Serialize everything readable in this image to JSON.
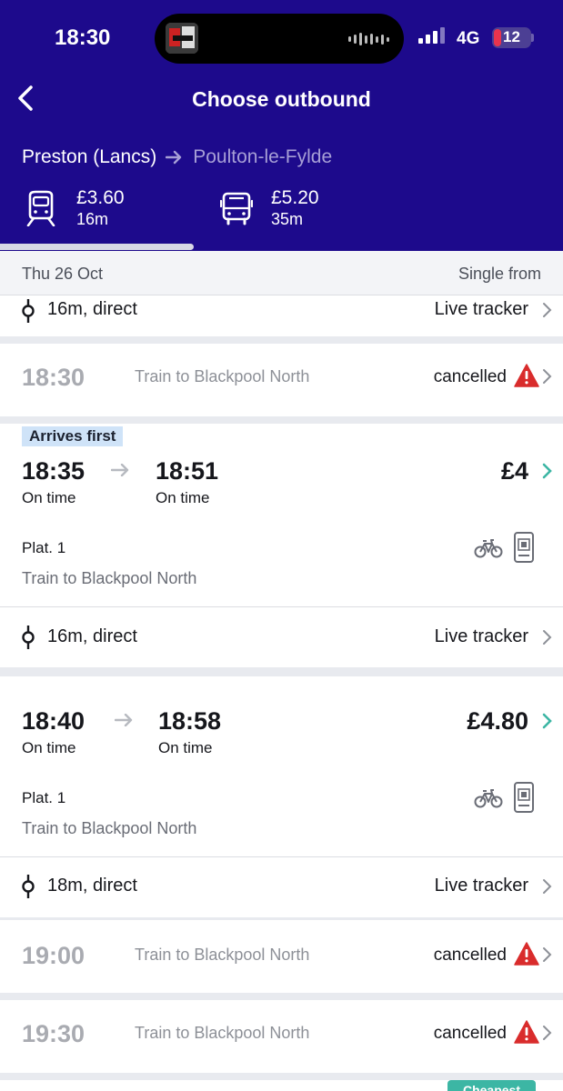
{
  "status_bar": {
    "time": "18:30",
    "network": "4G",
    "battery": "12"
  },
  "header": {
    "title": "Choose outbound",
    "origin": "Preston (Lancs)",
    "destination": "Poulton-le-Fylde",
    "modes": [
      {
        "icon": "train-icon",
        "price": "£3.60",
        "duration": "16m",
        "selected": true
      },
      {
        "icon": "bus-icon",
        "price": "£5.20",
        "duration": "35m",
        "selected": false
      }
    ]
  },
  "subheader": {
    "date": "Thu 26 Oct",
    "single_from": "Single from"
  },
  "partial_row": {
    "summary": "16m, direct",
    "live": "Live tracker"
  },
  "cancelled": [
    {
      "time": "18:30",
      "destination": "Train to Blackpool North",
      "status": "cancelled"
    },
    {
      "time": "19:00",
      "destination": "Train to Blackpool North",
      "status": "cancelled"
    },
    {
      "time": "19:30",
      "destination": "Train to Blackpool North",
      "status": "cancelled"
    }
  ],
  "journeys": [
    {
      "badge": "Arrives first",
      "depart": "18:35",
      "depart_status": "On time",
      "arrive": "18:51",
      "arrive_status": "On time",
      "fare": "£4",
      "platform": "Plat. 1",
      "destination": "Train to Blackpool North",
      "summary": "16m, direct",
      "live": "Live tracker"
    },
    {
      "depart": "18:40",
      "depart_status": "On time",
      "arrive": "18:58",
      "arrive_status": "On time",
      "fare": "£4.80",
      "platform": "Plat. 1",
      "destination": "Train to Blackpool North",
      "summary": "18m, direct",
      "live": "Live tracker"
    }
  ],
  "bottom_badge": "Cheapest",
  "colors": {
    "header_bg": "#1d0a8c",
    "accent_teal": "#3cb6a4",
    "warning_red": "#d92c2c"
  }
}
